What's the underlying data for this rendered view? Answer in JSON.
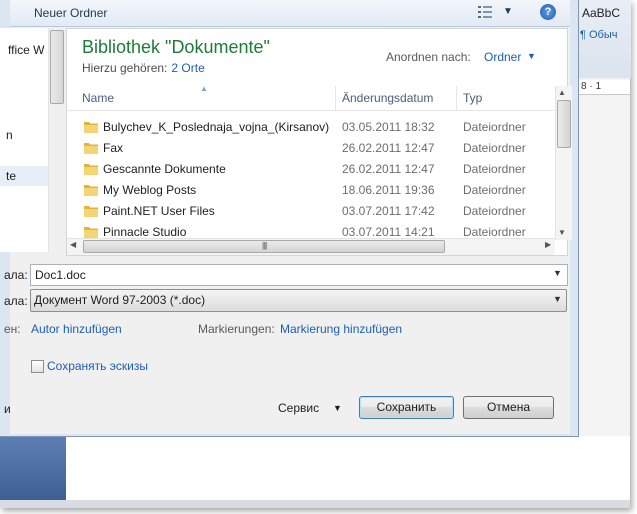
{
  "toolbar": {
    "new_folder": "Neuer Ordner",
    "help": "?"
  },
  "nav": {
    "item1": "ffice W",
    "item2": "n",
    "item3": "te"
  },
  "library": {
    "title": "Bibliothek \"Dokumente\"",
    "includes_label": "Hierzu gehören:",
    "includes_link": "2 Orte",
    "arrange_label": "Anordnen nach:",
    "arrange_value": "Ordner"
  },
  "columns": {
    "name": "Name",
    "date": "Änderungsdatum",
    "type": "Typ"
  },
  "files": [
    {
      "name": "Bulychev_K_Poslednaja_vojna_(Kirsanov)",
      "date": "03.05.2011 18:32",
      "type": "Dateiordner"
    },
    {
      "name": "Fax",
      "date": "26.02.2011 12:47",
      "type": "Dateiordner"
    },
    {
      "name": "Gescannte Dokumente",
      "date": "26.02.2011 12:47",
      "type": "Dateiordner"
    },
    {
      "name": "My Weblog Posts",
      "date": "18.06.2011 19:36",
      "type": "Dateiordner"
    },
    {
      "name": "Paint.NET User Files",
      "date": "03.07.2011 17:42",
      "type": "Dateiordner"
    },
    {
      "name": "Pinnacle Studio",
      "date": "03.07.2011 14:21",
      "type": "Dateiordner"
    }
  ],
  "form": {
    "filename_label": "ала:",
    "filename_value": "Doc1.doc",
    "filetype_label": "ала:",
    "filetype_value": "Документ Word 97-2003 (*.doc)",
    "authors_label": "ен:",
    "authors_link": "Autor hinzufügen",
    "tags_label": "Markierungen:",
    "tags_link": "Markierung hinzufügen",
    "thumbnails_label": "Сохранять эскизы",
    "hide_folders": "и",
    "service": "Сервис",
    "save": "Сохранить",
    "cancel": "Отмена"
  },
  "word_background": {
    "style_preview": "AaBbC",
    "style_name": "¶ Обыч",
    "ruler": "8 · 1"
  },
  "colors": {
    "title_green": "#1e7b38",
    "link_blue": "#1e5fb3",
    "folder_yellow": "#e8c24a"
  }
}
